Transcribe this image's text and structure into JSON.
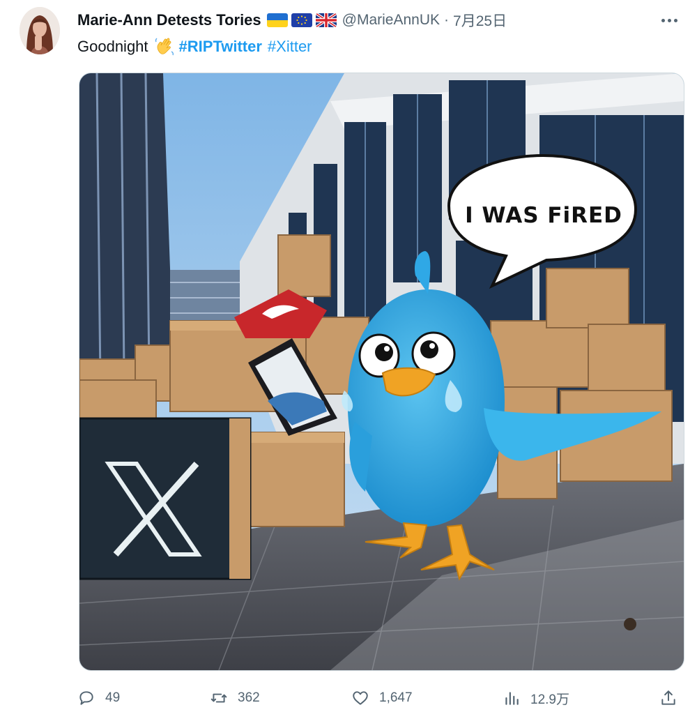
{
  "author": {
    "display_name": "Marie-Ann Detests Tories",
    "flags": [
      "ukraine-flag-icon",
      "eu-flag-icon",
      "uk-flag-icon"
    ],
    "handle": "@MarieAnnUK",
    "separator": "·",
    "timestamp": "7月25日"
  },
  "tweet": {
    "text": "Goodnight",
    "emoji": "waving-hand-icon",
    "hashtags": [
      "#RIPTwitter",
      "#Xitter"
    ]
  },
  "media": {
    "bubble_text": "I WAS FiRED"
  },
  "actions": {
    "replies": "49",
    "retweets": "362",
    "likes": "1,647",
    "views": "12.9万"
  },
  "colors": {
    "link": "#1d9bf0",
    "secondary_text": "#536471",
    "primary_text": "#0f1419"
  }
}
